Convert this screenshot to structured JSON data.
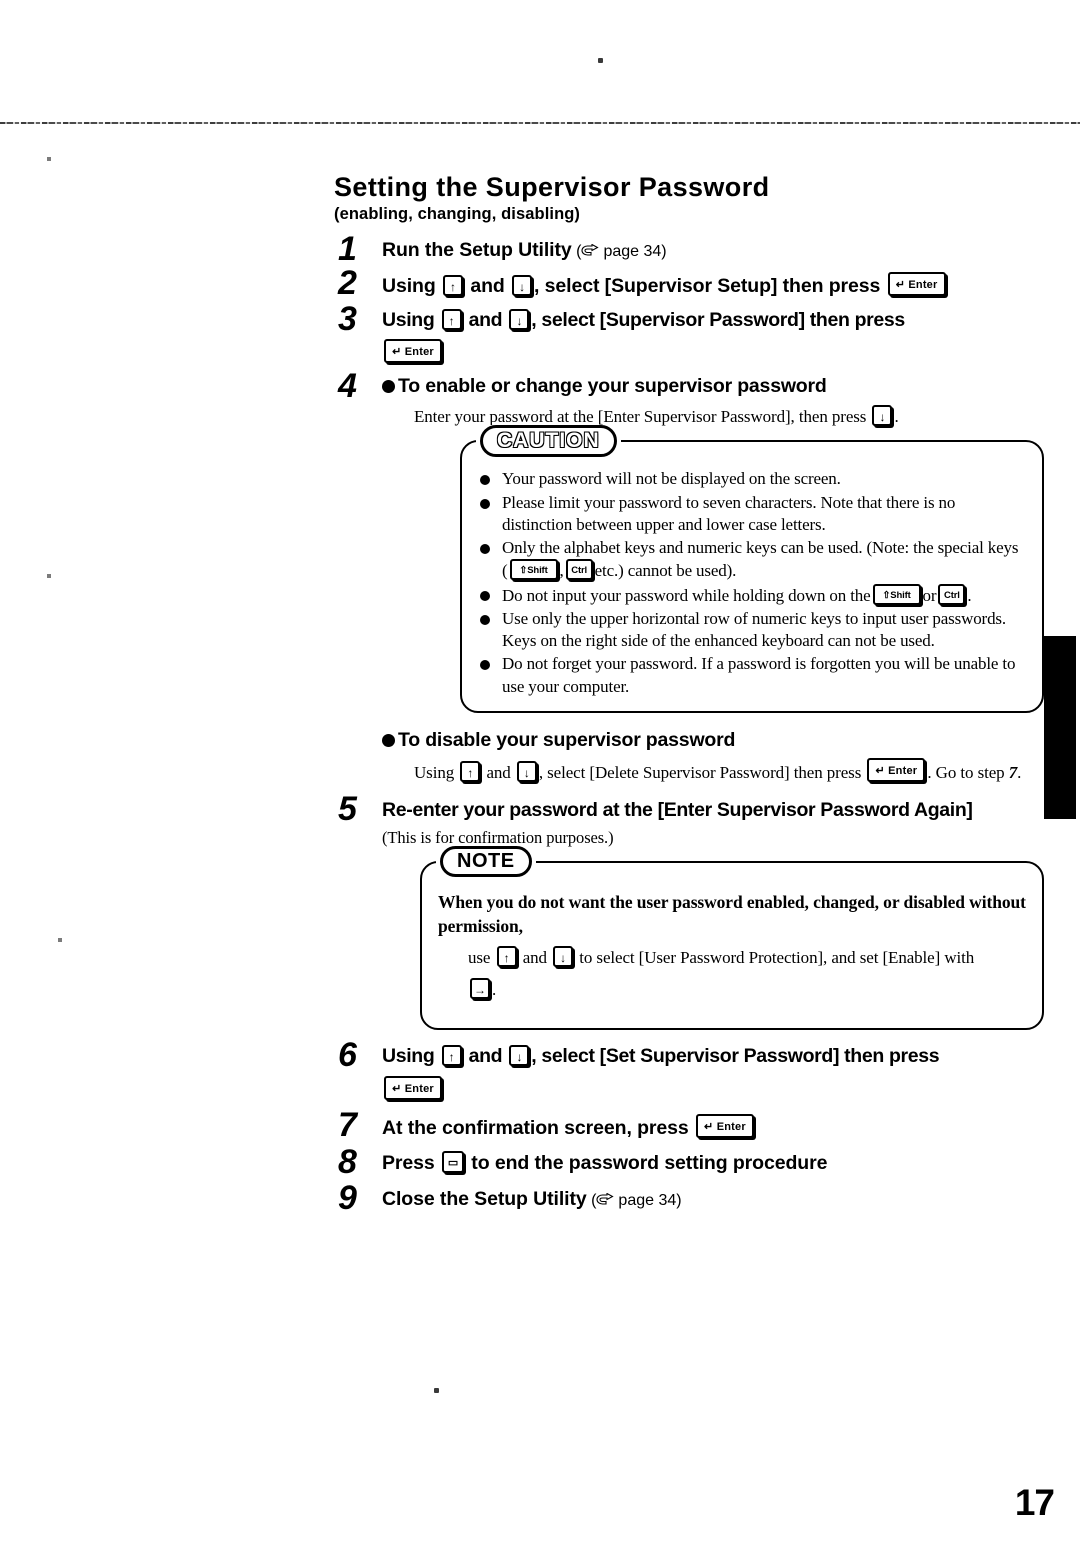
{
  "document": {
    "page_number": "17",
    "title": "Setting the Supervisor Password",
    "subtitle": "(enabling, changing, disabling)"
  },
  "icons": {
    "up_arrow_key": "up-arrow-key",
    "down_arrow_key": "down-arrow-key",
    "enter_key": "enter-key",
    "shift_key": "shift-key",
    "ctrl_key": "ctrl-key",
    "space_key": "space-key",
    "right_arrow_key": "right-arrow-key",
    "hand_pointer": "pointing-hand-icon"
  },
  "key_labels": {
    "up": "↑",
    "down": "↓",
    "right": "→",
    "enter_arrow": "↵",
    "enter_text": "Enter",
    "shift_text": "Shift",
    "shift_arrow": "⇧",
    "ctrl_text": "Ctrl",
    "fn_text": "▭"
  },
  "steps": {
    "one": {
      "num": "1",
      "text": "Run the Setup Utility",
      "ref_open": "(",
      "ref_page": "page 34",
      "ref_close": ")"
    },
    "two": {
      "num": "2",
      "t1": "Using",
      "t2": "and",
      "t3": ", select [Supervisor Setup] then press"
    },
    "three": {
      "num": "3",
      "t1": "Using",
      "t2": "and",
      "t3": ", select [Supervisor Password] then press"
    },
    "four": {
      "num": "4",
      "heading": "To enable or change your supervisor password",
      "body_pre": "Enter your password at the [Enter Supervisor Password], then press",
      "body_post": "."
    },
    "five": {
      "num": "5",
      "text": "Re-enter your password at the [Enter Supervisor Password Again]",
      "note": "(This is for confirmation purposes.)"
    },
    "six": {
      "num": "6",
      "t1": "Using",
      "t2": "and",
      "t3": ", select [Set Supervisor Password] then press"
    },
    "seven": {
      "num": "7",
      "text": "At the confirmation screen, press"
    },
    "eight": {
      "num": "8",
      "t1": "Press",
      "t2": "to end the password setting procedure"
    },
    "nine": {
      "num": "9",
      "text": "Close the Setup Utility",
      "ref_open": "(",
      "ref_page": "page 34",
      "ref_close": ")"
    }
  },
  "caution": {
    "badge": "CAUTION",
    "items": {
      "i1": "Your password will not be displayed on the screen.",
      "i2": "Please limit your password to seven characters.  Note that there is no distinction between upper and lower case letters.",
      "i3_pre": "Only the alphabet keys and numeric keys can be used. (Note: the special keys (",
      "i3_mid": ",",
      "i3_post": "etc.) cannot be used).",
      "i4_pre": "Do not input your password while holding down on the",
      "i4_mid": "or",
      "i4_post": ".",
      "i5": "Use only the upper horizontal row of numeric keys to input user passwords. Keys on the right side of the enhanced keyboard can not be used.",
      "i6": "Do not forget your password.  If a password is forgotten you will be unable to use your computer."
    }
  },
  "disable_section": {
    "heading": "To disable your supervisor password",
    "t1": "Using",
    "t2": "and",
    "t3": ", select [Delete Supervisor Password] then press",
    "t4": ".  Go to step",
    "t5": "7",
    "t6": "."
  },
  "note": {
    "badge": "NOTE",
    "bold_text": "When you do not want the user password enabled, changed, or disabled without permission,",
    "body_pre": "use",
    "body_mid": "and",
    "body_post": "to select [User Password Protection], and set [Enable] with",
    "body_end": "."
  }
}
